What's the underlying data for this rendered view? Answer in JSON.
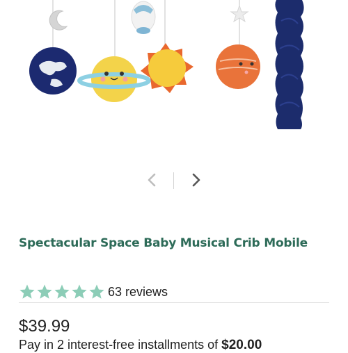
{
  "product": {
    "title": "Spectacular Space Baby Musical Crib Mobile",
    "rating": 5,
    "review_count": "63 reviews",
    "price": "$39.99",
    "installments_text": "Pay in 2 interest-free installments of",
    "installment_amount": "$20.00"
  },
  "carousel": {
    "items": [
      "moon-plush",
      "rocket-plush",
      "star-plush",
      "earth-plush",
      "saturn-plush",
      "sun-plush",
      "mars-plush",
      "arm-cover"
    ]
  },
  "colors": {
    "accent_green": "#2d6b58",
    "star_teal": "#8ccdb7"
  }
}
